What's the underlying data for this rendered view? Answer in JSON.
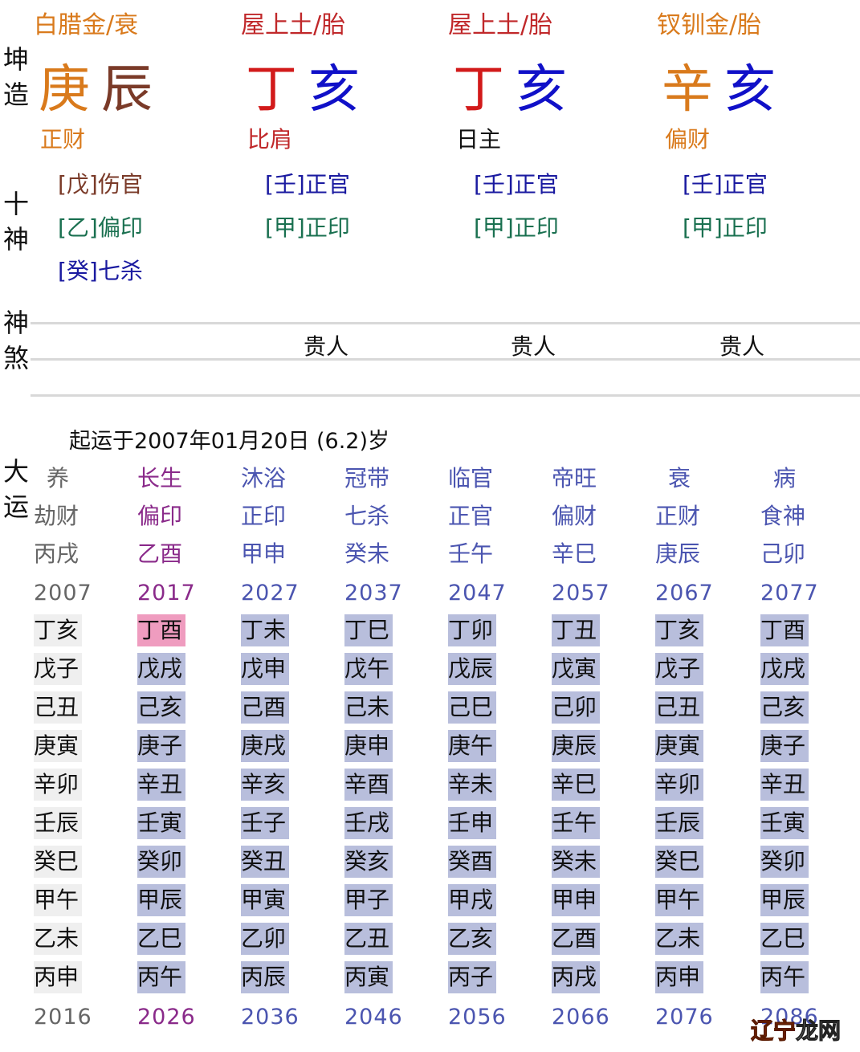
{
  "side_labels": {
    "chart": [
      "坤",
      "造"
    ],
    "shishen": [
      "十",
      "神"
    ],
    "shensha": [
      "神",
      "煞"
    ],
    "dayun": [
      "大",
      "运"
    ]
  },
  "pillars": [
    {
      "nayin": "白腊金/衰",
      "stem": "庚",
      "branch": "辰",
      "shishen": "正财",
      "hidden": [
        "[戊]伤官",
        "[乙]偏印",
        "[癸]七杀"
      ],
      "shensha": ""
    },
    {
      "nayin": "屋上土/胎",
      "stem": "丁",
      "branch": "亥",
      "shishen": "比肩",
      "hidden": [
        "[壬]正官",
        "[甲]正印"
      ],
      "shensha": "贵人"
    },
    {
      "nayin": "屋上土/胎",
      "stem": "丁",
      "branch": "亥",
      "shishen": "日主",
      "hidden": [
        "[壬]正官",
        "[甲]正印"
      ],
      "shensha": "贵人"
    },
    {
      "nayin": "钗钏金/胎",
      "stem": "辛",
      "branch": "亥",
      "shishen": "偏财",
      "hidden": [
        "[壬]正官",
        "[甲]正印"
      ],
      "shensha": "贵人"
    }
  ],
  "qiyun_text": "起运于2007年01月20日 (6.2)岁",
  "dayun": [
    {
      "stage": "养",
      "shishen": "劫财",
      "ganzhi": "丙戌",
      "start_year": "2007",
      "end_year": "2016",
      "years": [
        "丁亥",
        "戊子",
        "己丑",
        "庚寅",
        "辛卯",
        "壬辰",
        "癸巳",
        "甲午",
        "乙未",
        "丙申"
      ]
    },
    {
      "stage": "长生",
      "shishen": "偏印",
      "ganzhi": "乙酉",
      "start_year": "2017",
      "end_year": "2026",
      "years": [
        "丁酉",
        "戊戌",
        "己亥",
        "庚子",
        "辛丑",
        "壬寅",
        "癸卯",
        "甲辰",
        "乙巳",
        "丙午"
      ]
    },
    {
      "stage": "沐浴",
      "shishen": "正印",
      "ganzhi": "甲申",
      "start_year": "2027",
      "end_year": "2036",
      "years": [
        "丁未",
        "戊申",
        "己酉",
        "庚戌",
        "辛亥",
        "壬子",
        "癸丑",
        "甲寅",
        "乙卯",
        "丙辰"
      ]
    },
    {
      "stage": "冠带",
      "shishen": "七杀",
      "ganzhi": "癸未",
      "start_year": "2037",
      "end_year": "2046",
      "years": [
        "丁巳",
        "戊午",
        "己未",
        "庚申",
        "辛酉",
        "壬戌",
        "癸亥",
        "甲子",
        "乙丑",
        "丙寅"
      ]
    },
    {
      "stage": "临官",
      "shishen": "正官",
      "ganzhi": "壬午",
      "start_year": "2047",
      "end_year": "2056",
      "years": [
        "丁卯",
        "戊辰",
        "己巳",
        "庚午",
        "辛未",
        "壬申",
        "癸酉",
        "甲戌",
        "乙亥",
        "丙子"
      ]
    },
    {
      "stage": "帝旺",
      "shishen": "偏财",
      "ganzhi": "辛巳",
      "start_year": "2057",
      "end_year": "2066",
      "years": [
        "丁丑",
        "戊寅",
        "己卯",
        "庚辰",
        "辛巳",
        "壬午",
        "癸未",
        "甲申",
        "乙酉",
        "丙戌"
      ]
    },
    {
      "stage": "衰",
      "shishen": "正财",
      "ganzhi": "庚辰",
      "start_year": "2067",
      "end_year": "2076",
      "years": [
        "丁亥",
        "戊子",
        "己丑",
        "庚寅",
        "辛卯",
        "壬辰",
        "癸巳",
        "甲午",
        "乙未",
        "丙申"
      ]
    },
    {
      "stage": "病",
      "shishen": "食神",
      "ganzhi": "己卯",
      "start_year": "2077",
      "end_year": "2086",
      "years": [
        "丁酉",
        "戊戌",
        "己亥",
        "庚子",
        "辛丑",
        "壬寅",
        "癸卯",
        "甲辰",
        "乙巳",
        "丙午"
      ]
    }
  ],
  "current_year": "丁酉",
  "watermark": {
    "part1": "辽宁",
    "part2": "龙网"
  }
}
